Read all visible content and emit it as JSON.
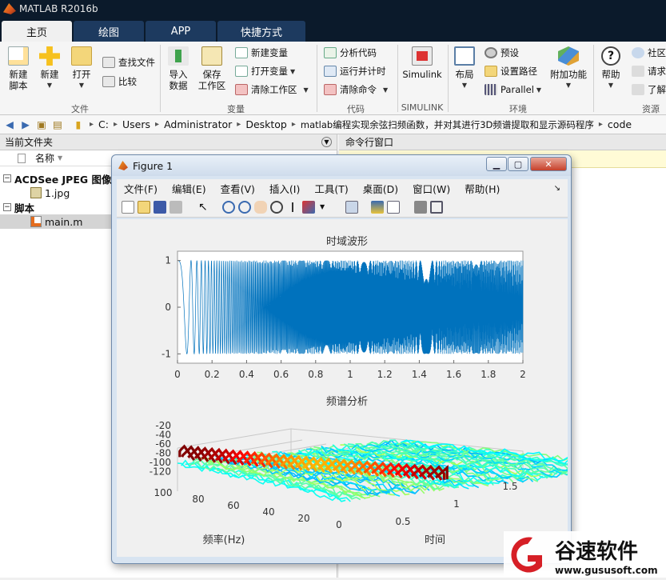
{
  "app": {
    "title": "MATLAB R2016b"
  },
  "tabs": [
    {
      "label": "主页",
      "active": true
    },
    {
      "label": "绘图",
      "active": false
    },
    {
      "label": "APP",
      "active": false
    },
    {
      "label": "快捷方式",
      "active": false
    }
  ],
  "toolstrip": {
    "new_script": "新建\n脚本",
    "new": "新建",
    "open": "打开",
    "find_files": "查找文件",
    "compare": "比较",
    "import_data": "导入\n数据",
    "save_workspace": "保存\n工作区",
    "new_variable": "新建变量",
    "open_variable": "打开变量",
    "clear_workspace": "清除工作区",
    "analyze_code": "分析代码",
    "run_and_time": "运行并计时",
    "clear_commands": "清除命令",
    "simulink": "Simulink",
    "layout": "布局",
    "preferences": "预设",
    "set_path": "设置路径",
    "parallel": "Parallel",
    "addons": "附加功能",
    "help": "帮助",
    "community": "社区",
    "request_support": "请求",
    "learn": "了解",
    "groups": {
      "file": "文件",
      "variable": "变量",
      "code": "代码",
      "simulink": "SIMULINK",
      "environment": "环境",
      "resources": "资源"
    }
  },
  "address": {
    "crumbs": [
      "C:",
      "Users",
      "Administrator",
      "Desktop",
      "matlab编程实现余弦扫频函数，并对其进行3D频谱提取和显示源码程序",
      "code"
    ]
  },
  "current_folder": {
    "title": "当前文件夹",
    "column": "名称",
    "groups": [
      {
        "label": "ACDSee JPEG 图像",
        "files": [
          "1.jpg"
        ]
      },
      {
        "label": "脚本",
        "files": [
          "main.m"
        ]
      }
    ]
  },
  "command_window": {
    "title": "命令行窗口"
  },
  "figure": {
    "title": "Figure 1",
    "menu": [
      "文件(F)",
      "编辑(E)",
      "查看(V)",
      "插入(I)",
      "工具(T)",
      "桌面(D)",
      "窗口(W)",
      "帮助(H)"
    ]
  },
  "chart_data": [
    {
      "type": "line",
      "title": "时域波形",
      "xlim": [
        0,
        2
      ],
      "ylim": [
        -1.2,
        1.2
      ],
      "xticks": [
        "0",
        "0.2",
        "0.4",
        "0.6",
        "0.8",
        "1",
        "1.2",
        "1.4",
        "1.6",
        "1.8",
        "2"
      ],
      "yticks": [
        "1",
        "0",
        "-1"
      ],
      "color": "#0072bd"
    },
    {
      "type": "surface",
      "title": "频谱分析",
      "xlabel": "频率(Hz)",
      "ylabel": "时间",
      "zticks": [
        "-20",
        "-40",
        "-60",
        "-80",
        "-100",
        "-120"
      ],
      "freq_ticks": [
        "100",
        "80",
        "60",
        "40",
        "20",
        "0"
      ],
      "time_ticks": [
        "0.5",
        "1",
        "1.5"
      ]
    }
  ],
  "watermark": {
    "brand": "谷速软件",
    "url": "www.gususoft.com"
  }
}
